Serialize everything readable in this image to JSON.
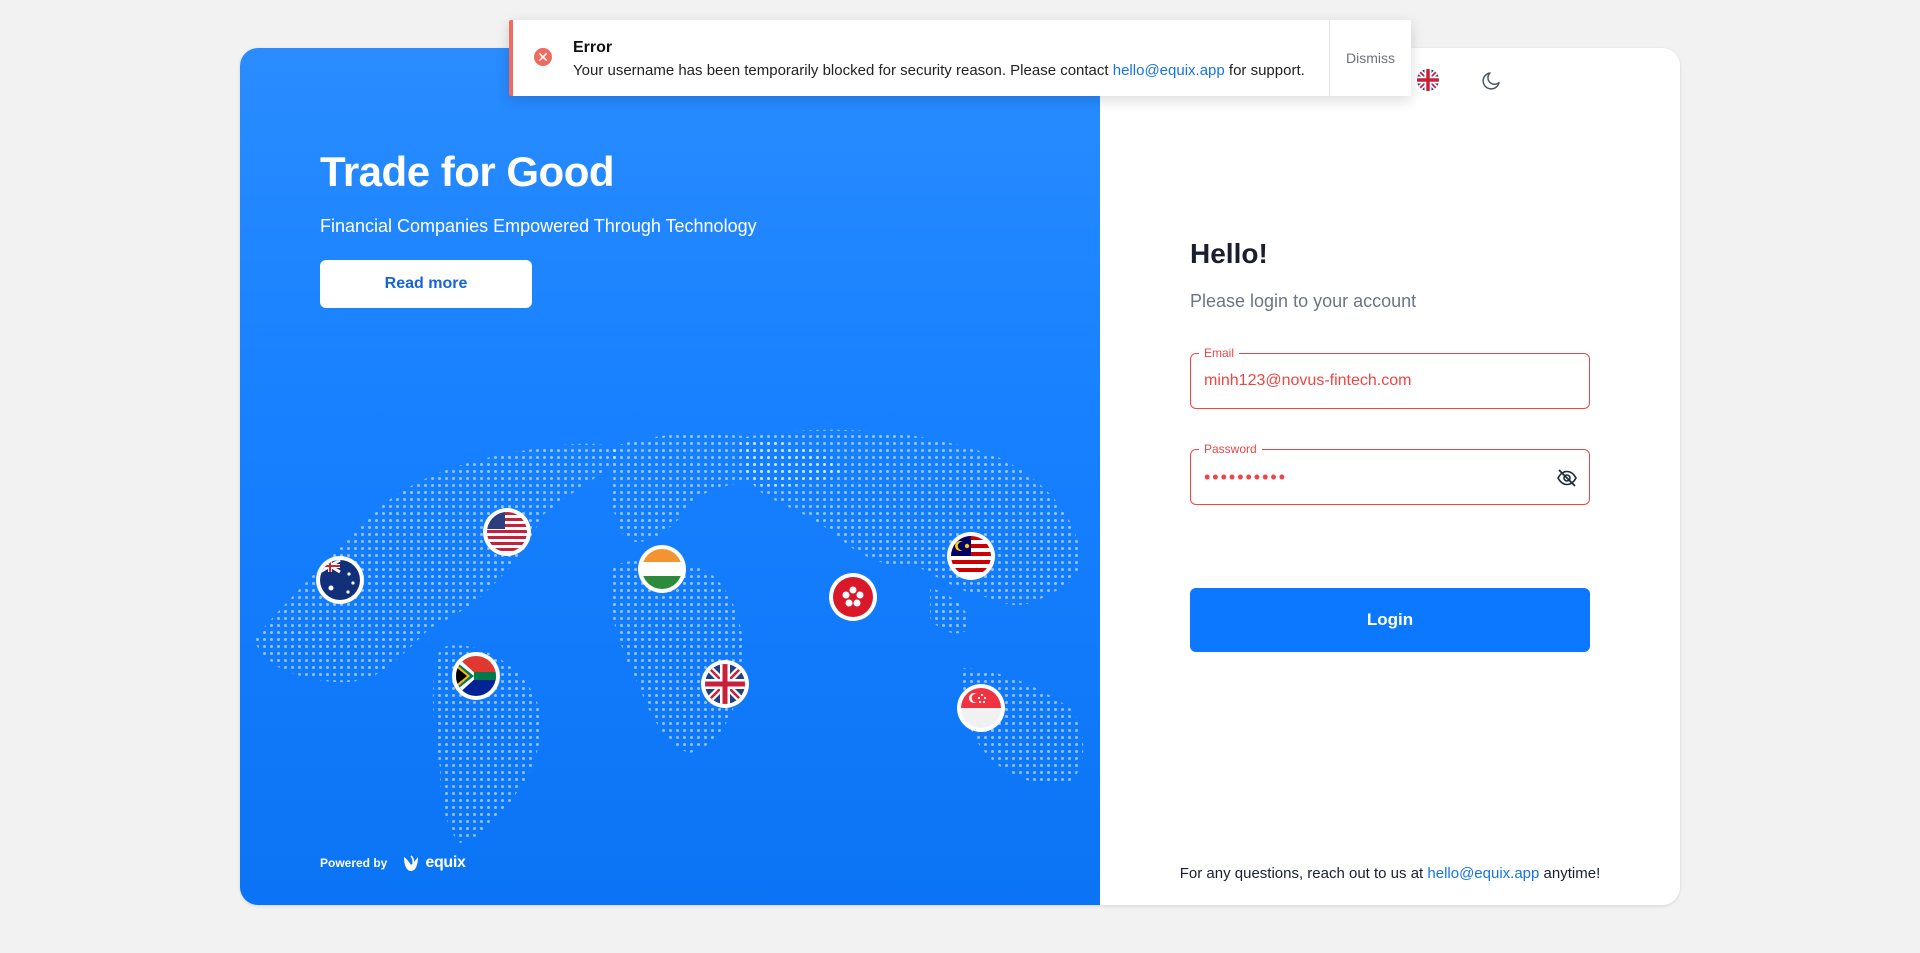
{
  "hero": {
    "title": "Trade for Good",
    "subtitle": "Financial Companies Empowered Through Technology",
    "read_more_label": "Read more",
    "powered_by_label": "Powered by",
    "brand_name": "equix",
    "flags": [
      "australia",
      "united-states",
      "south-africa",
      "india",
      "united-kingdom",
      "hong-kong",
      "malaysia",
      "singapore"
    ]
  },
  "header": {
    "language_icon": "uk-flag-icon",
    "theme_icon": "moon-icon"
  },
  "login": {
    "title": "Hello!",
    "subtitle": "Please login to your account",
    "email_label": "Email",
    "email_value": "minh123@novus-fintech.com",
    "password_label": "Password",
    "password_value": "••••••••••",
    "password_toggle_icon": "eye-off-icon",
    "login_label": "Login",
    "footer_prefix": "For any questions, reach out to us at",
    "footer_email": "hello@equix.app",
    "footer_suffix": "anytime!"
  },
  "toast": {
    "title": "Error",
    "message_prefix": "Your username has been temporarily blocked for security reason. Please contact",
    "message_email": "hello@equix.app",
    "message_suffix": "for support.",
    "dismiss_label": "Dismiss",
    "icon": "error-circle-icon"
  },
  "colors": {
    "primary": "#0b78ff",
    "hero_blue": "#1680ff",
    "error": "#ef4444",
    "link": "#1674e8"
  }
}
